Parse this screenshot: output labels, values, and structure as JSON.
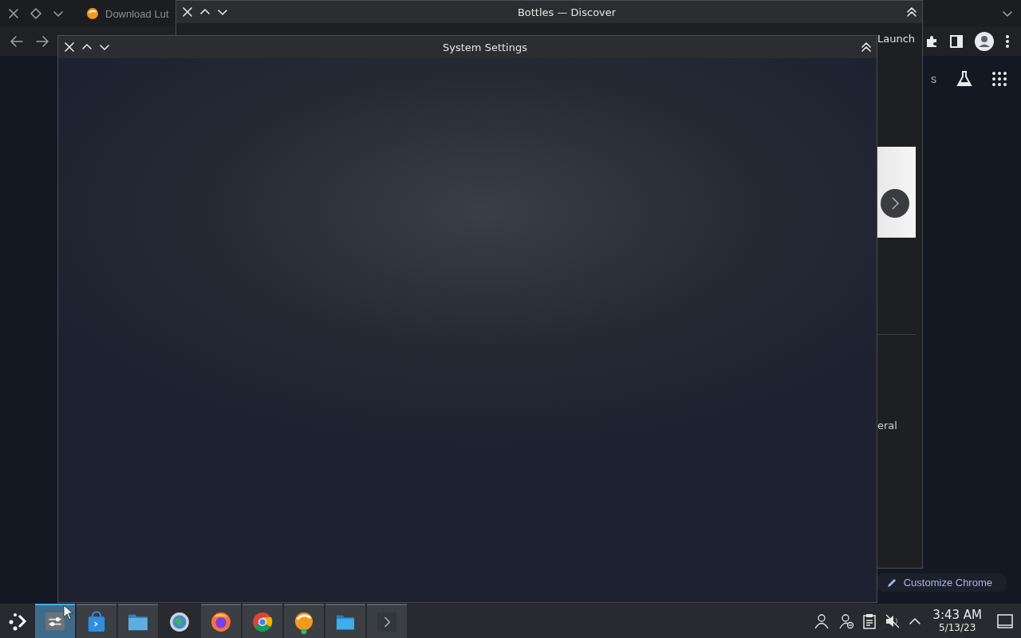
{
  "browser": {
    "tab_title": "Download Lut",
    "page_text": "s",
    "customize_button": "Customize Chrome"
  },
  "windows": [
    {
      "title": "Bottles — Discover",
      "launch": "Launch",
      "text": "eral"
    },
    {
      "title": "System Settings"
    }
  ],
  "taskbar": {
    "tasks": [
      {
        "kind": "sliders",
        "selected": true,
        "open": true
      },
      {
        "kind": "store",
        "selected": false,
        "open": true
      },
      {
        "kind": "files",
        "selected": false,
        "open": true
      },
      {
        "kind": "globe",
        "selected": false,
        "open": false
      },
      {
        "kind": "firefox",
        "selected": false,
        "open": true
      },
      {
        "kind": "chrome",
        "selected": false,
        "open": true
      },
      {
        "kind": "lutris",
        "selected": false,
        "open": true
      },
      {
        "kind": "folder",
        "selected": false,
        "open": true
      },
      {
        "kind": "terminal",
        "selected": false,
        "open": true
      }
    ],
    "time": "3:43 AM",
    "date": "5/13/23"
  }
}
